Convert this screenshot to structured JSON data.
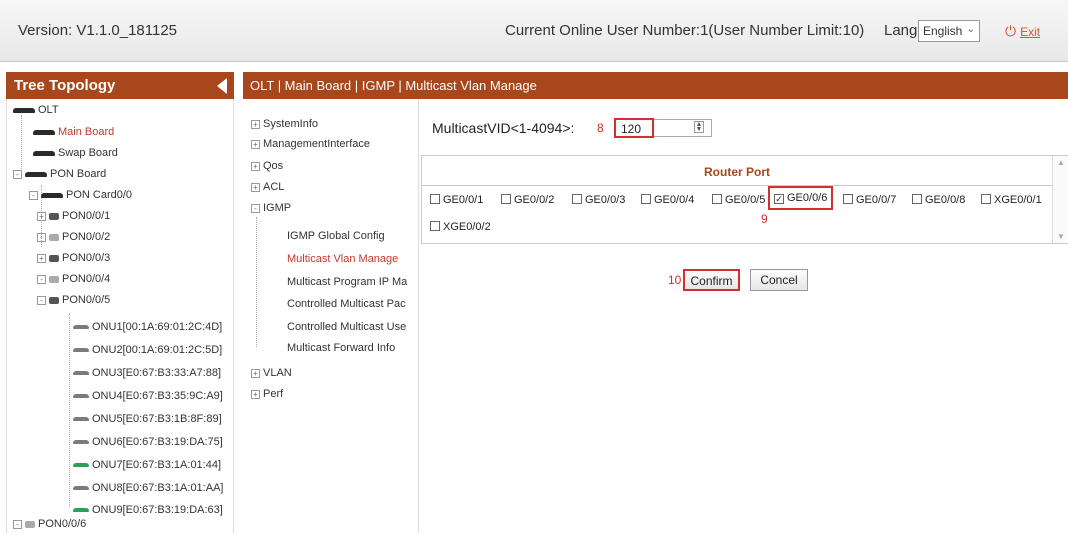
{
  "header": {
    "version": "Version: V1.1.0_181125",
    "online": "Current Online User Number:1(User Number Limit:10)",
    "lang_label": "Lang",
    "lang_value": "English",
    "exit_label": "Exit"
  },
  "tree": {
    "title": "Tree Topology",
    "olt": "OLT",
    "main_board": "Main Board",
    "swap_board": "Swap Board",
    "pon_board": "PON Board",
    "pon_card": "PON Card0/0",
    "pons": [
      "PON0/0/1",
      "PON0/0/2",
      "PON0/0/3",
      "PON0/0/4",
      "PON0/0/5"
    ],
    "onus": [
      "ONU1[00:1A:69:01:2C:4D]",
      "ONU2[00:1A:69:01:2C:5D]",
      "ONU3[E0:67:B3:33:A7:88]",
      "ONU4[E0:67:B3:35:9C:A9]",
      "ONU5[E0:67:B3:1B:8F:89]",
      "ONU6[E0:67:B3:19:DA:75]",
      "ONU7[E0:67:B3:1A:01:44]",
      "ONU8[E0:67:B3:1A:01:AA]",
      "ONU9[E0:67:B3:19:DA:63]"
    ],
    "pon6": "PON0/0/6"
  },
  "breadcrumb": "OLT | Main Board | IGMP | Multicast Vlan Manage",
  "menu": {
    "systeminfo": "SystemInfo",
    "management": "ManagementInterface",
    "qos": "Qos",
    "acl": "ACL",
    "igmp": "IGMP",
    "igmp_children": [
      "IGMP Global Config",
      "Multicast Vlan Manage",
      "Multicast Program IP Ma",
      "Controlled Multicast Pac",
      "Controlled Multicast Use",
      "Multicast Forward Info"
    ],
    "vlan": "VLAN",
    "perf": "Perf"
  },
  "form": {
    "vid_label": "MulticastVID<1-4094>:",
    "vid_value": "120",
    "router_title": "Router Port",
    "ports": [
      "GE0/0/1",
      "GE0/0/2",
      "GE0/0/3",
      "GE0/0/4",
      "GE0/0/5",
      "GE0/0/6",
      "GE0/0/7",
      "GE0/0/8",
      "XGE0/0/1",
      "XGE0/0/2"
    ],
    "checked_port": "GE0/0/6",
    "confirm": "Confirm",
    "cancel": "Concel"
  },
  "annotations": {
    "n8": "8",
    "n9": "9",
    "n10": "10"
  },
  "colors": {
    "brand": "#a8471b",
    "highlight": "#d32f2f"
  }
}
